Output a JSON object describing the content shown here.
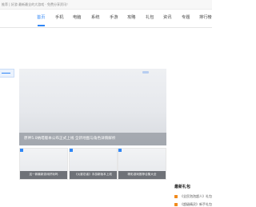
{
  "topbar": {
    "text": "推荐 | 好游 最新最全的大游戏 · 免费分享资讯！"
  },
  "nav": {
    "items": [
      {
        "label": "首页",
        "active": true
      },
      {
        "label": "手机",
        "active": false
      },
      {
        "label": "电脑",
        "active": false
      },
      {
        "label": "系统",
        "active": false
      },
      {
        "label": "手游",
        "active": false
      },
      {
        "label": "攻略",
        "active": false
      },
      {
        "label": "礼包",
        "active": false
      },
      {
        "label": "资讯",
        "active": false
      },
      {
        "label": "专题",
        "active": false
      },
      {
        "label": "排行榜",
        "active": false
      }
    ],
    "accent_color": "#2f86f6"
  },
  "banner": {
    "caption": "原神5.0纳塔版本公布正式上线 全新地图与角色详情解析"
  },
  "thumbnails": [
    {
      "caption": "这一款最新游戏好玩吗"
    },
    {
      "caption": "《火影忍者》手游新版本上线"
    },
    {
      "caption": "精彩游戏推荐合集大全"
    }
  ],
  "gifts": {
    "title": "最新礼包",
    "items": [
      {
        "label": "《全民泡泡超人》礼包"
      },
      {
        "label": "《超级精灵》新手礼包"
      }
    ],
    "icon": "gift-icon"
  }
}
